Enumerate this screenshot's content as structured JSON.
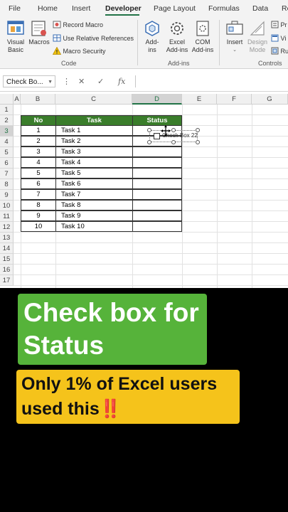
{
  "ribbon_tabs": [
    "File",
    "Home",
    "Insert",
    "Developer",
    "Page Layout",
    "Formulas",
    "Data",
    "Re"
  ],
  "active_tab": "Developer",
  "code_group": {
    "visual_basic": "Visual Basic",
    "macros": "Macros",
    "record_macro": "Record Macro",
    "relative_refs": "Use Relative References",
    "macro_security": "Macro Security",
    "label": "Code"
  },
  "addins_group": {
    "addins": "Add-ins",
    "excel_addins": "Excel Add-ins",
    "com_addins": "COM Add-ins",
    "label": "Add-ins"
  },
  "controls_group": {
    "insert": "Insert",
    "design_mode": "Design Mode",
    "properties": "Pr",
    "view_code": "Vi",
    "run_dialog": "Ru",
    "label": "Controls"
  },
  "formula_bar": {
    "name_box": "Check Bo...",
    "fx": "fx"
  },
  "columns": [
    "A",
    "B",
    "C",
    "D",
    "E",
    "F",
    "G"
  ],
  "selected_column": "D",
  "rows": [
    "1",
    "2",
    "3",
    "4",
    "5",
    "6",
    "7",
    "8",
    "9",
    "10",
    "11",
    "12",
    "13",
    "14",
    "15",
    "16",
    "17"
  ],
  "selected_row": "3",
  "table": {
    "headers": [
      "No",
      "Task",
      "Status"
    ],
    "rows": [
      {
        "no": "1",
        "task": "Task 1"
      },
      {
        "no": "2",
        "task": "Task 2"
      },
      {
        "no": "3",
        "task": "Task 3"
      },
      {
        "no": "4",
        "task": "Task 4"
      },
      {
        "no": "5",
        "task": "Task 5"
      },
      {
        "no": "6",
        "task": "Task 6"
      },
      {
        "no": "7",
        "task": "Task 7"
      },
      {
        "no": "8",
        "task": "Task 8"
      },
      {
        "no": "9",
        "task": "Task 9"
      },
      {
        "no": "10",
        "task": "Task 10"
      }
    ]
  },
  "checkbox_control": {
    "label": "Check Box 22"
  },
  "captions": {
    "title": "Check box for Status",
    "subtitle": "Only 1% of Excel users used this",
    "emoji": "‼️"
  },
  "colors": {
    "excel_green": "#217346",
    "header_green": "#3a7d2b",
    "caption_green": "#56b33a",
    "caption_yellow": "#f5c31b"
  }
}
